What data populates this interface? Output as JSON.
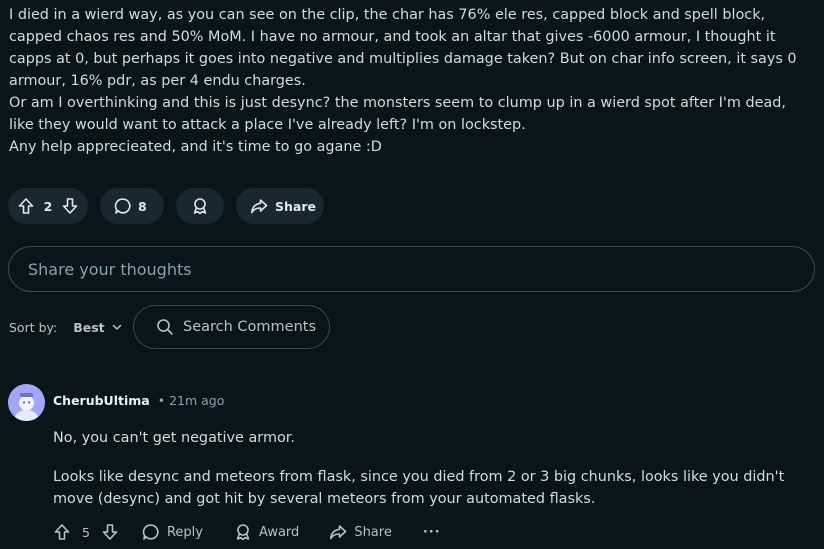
{
  "post": {
    "paragraphs": [
      "I died in a wierd way, as you can see on the clip, the char has 76% ele res, capped block and spell block, capped chaos res and 50% MoM. I have no armour, and took an altar that gives -6000 armour, I thought it capps at 0, but perhaps it goes into negative and multiplies damage taken? But on char info screen, it says 0 armour, 16% pdr, as per 4 endu charges.",
      "Or am I overthinking and this is just desync? the monsters seem to clump up in a wierd spot after I'm dead, like they would want to attack a place I've already left? I'm on lockstep.",
      "Any help apprecieated, and it's time to go agane :D"
    ]
  },
  "actions": {
    "vote_count": "2",
    "comment_count": "8",
    "share_label": "Share"
  },
  "composer": {
    "placeholder": "Share your thoughts"
  },
  "sort": {
    "label": "Sort by:",
    "value": "Best"
  },
  "search": {
    "placeholder": "Search Comments"
  },
  "comment": {
    "author": "CherubUltima",
    "separator": "•",
    "time": "21m ago",
    "paragraphs": [
      "No, you can't get negative armor.",
      "Looks like desync and meteors from flask, since you died from 2 or 3 big chunks, looks like you didn't move (desync) and got hit by several meteors from your automated flasks."
    ],
    "vote_count": "5",
    "reply_label": "Reply",
    "award_label": "Award",
    "share_label": "Share",
    "more_label": "···"
  },
  "colors": {
    "background": "#0b1416",
    "pill": "#1a282d",
    "avatar": "#a1a6f9"
  },
  "icons": [
    "upvote-icon",
    "downvote-icon",
    "comment-icon",
    "award-icon",
    "share-icon",
    "search-icon",
    "chevron-down-icon"
  ]
}
